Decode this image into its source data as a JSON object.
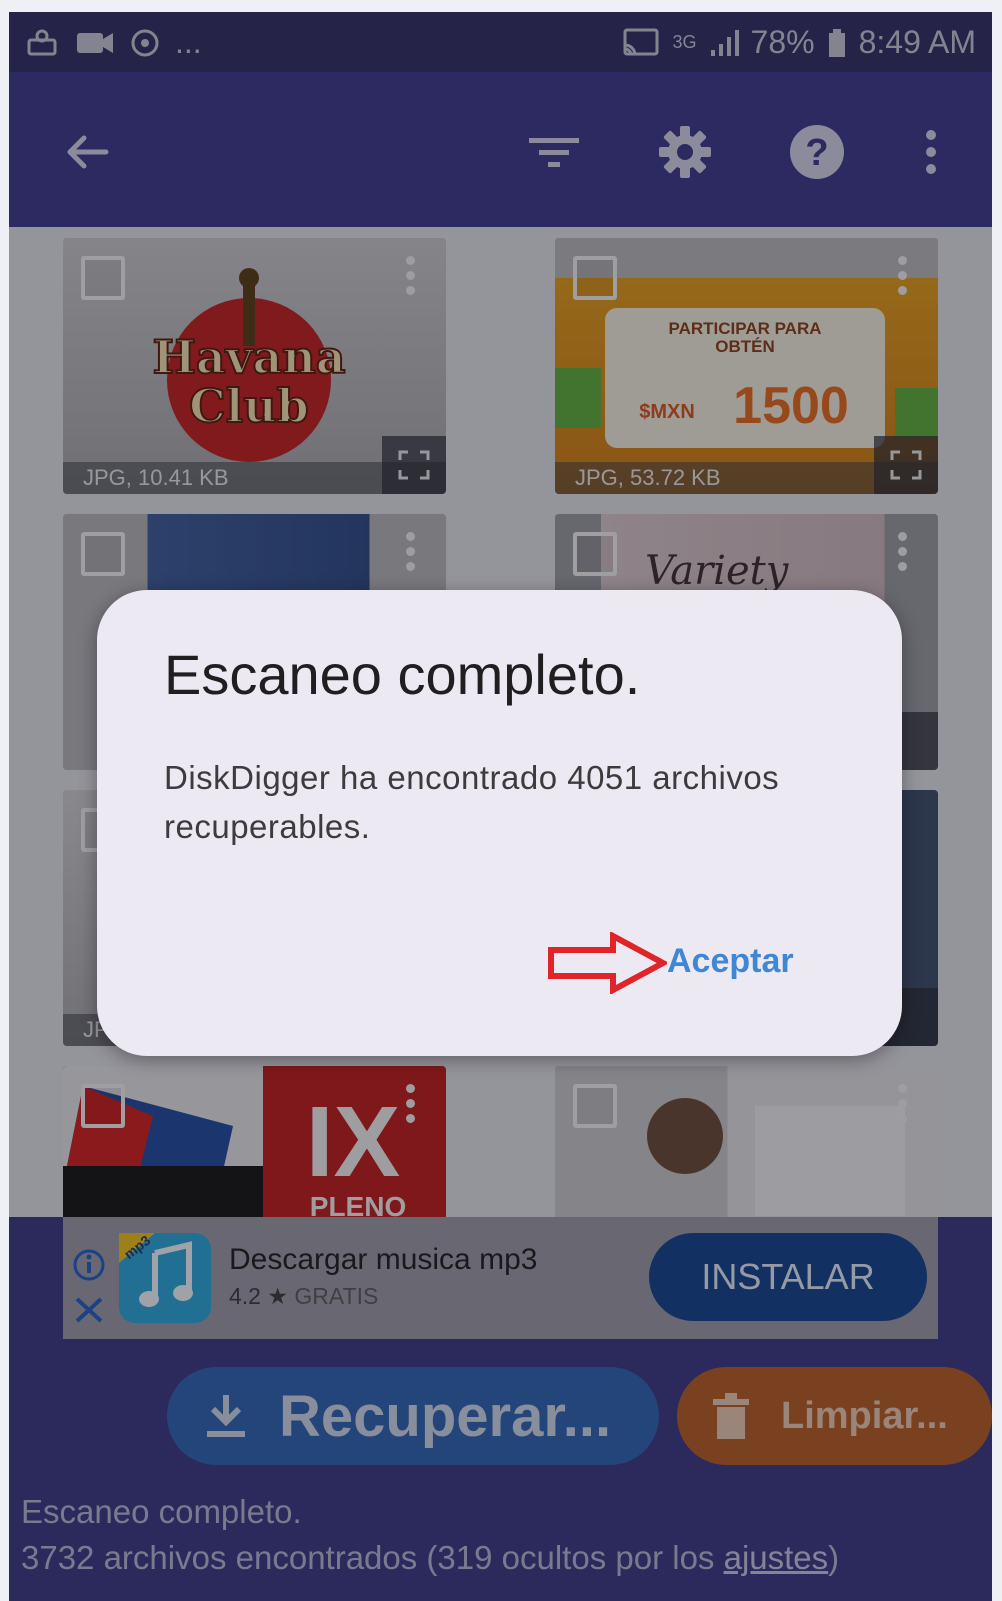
{
  "status_bar": {
    "left_icons": [
      "cast-notification-icon",
      "camera-icon",
      "sync-icon"
    ],
    "more": "...",
    "network": "3G",
    "battery": "78%",
    "time": "8:49 AM"
  },
  "app_bar": {
    "icons": [
      "back-arrow-icon",
      "filter-icon",
      "settings-icon",
      "help-icon",
      "more-vert-icon"
    ]
  },
  "tiles": [
    {
      "caption": "JPG, 10.41 KB",
      "logo_top": "Havana",
      "logo_bottom": "Club"
    },
    {
      "caption": "JPG, 53.72 KB",
      "line1": "PARTICIPAR PARA",
      "line2": "OBTÉN",
      "currency": "$MXN",
      "amount": "1500"
    },
    {
      "caption": ""
    },
    {
      "caption": "",
      "text": "Variety"
    },
    {
      "caption": "JP"
    },
    {
      "caption": ""
    },
    {
      "caption": "",
      "banner": "IX",
      "sub": "PLENO"
    },
    {
      "caption": ""
    }
  ],
  "dialog": {
    "title": "Escaneo completo.",
    "message": "DiskDigger ha encontrado 4051 archivos recuperables.",
    "accept": "Aceptar"
  },
  "ad": {
    "title": "Descargar musica mp3",
    "rating": "4.2",
    "price": "GRATIS",
    "badge": "mp3",
    "install": "INSTALAR"
  },
  "actions": {
    "recover": "Recuperar...",
    "clean": "Limpiar..."
  },
  "footer": {
    "line1": "Escaneo completo.",
    "line2_prefix": "3732 archivos encontrados (319 ocultos por los ",
    "line2_link": "ajustes",
    "line2_suffix": ")"
  },
  "colors": {
    "app_bar": "#3a378a",
    "dialog_bg": "#ede9f3",
    "accept": "#3f86d4",
    "recover": "#2d63b3",
    "clean": "#b85c25",
    "arrow": "#e0252a"
  }
}
